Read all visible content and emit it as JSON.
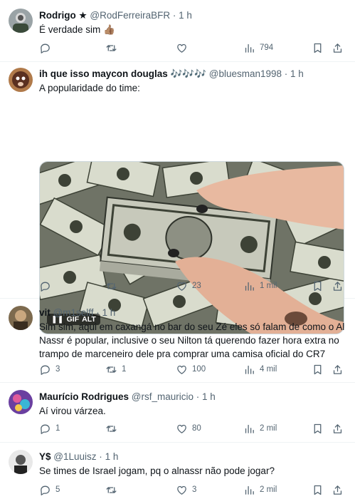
{
  "tweets": [
    {
      "name": "Rodrigo ★",
      "handle": "@RodFerreiraBFR",
      "time": "1 h",
      "text": "É verdade sim 👍🏽",
      "replies": "",
      "retweets": "",
      "likes": "",
      "views": "794"
    },
    {
      "name": "ih que isso maycon douglas 🎶🎶🎶",
      "handle": "@bluesman1998",
      "time": "1 h",
      "text": "A popularidade do time:",
      "replies": "",
      "retweets": "",
      "likes": "23",
      "views": "1 mil",
      "media": {
        "gif_label": "GIF",
        "alt_label": "ALT",
        "pause_icon": "pause-icon"
      }
    },
    {
      "name": "vit",
      "handle": "@m1selff",
      "time": "1 h",
      "text": "Sim sim, aqui em caxangá no bar do seu Zé eles só falam de como o Al Nassr é popular, inclusive o seu Nilton tá querendo fazer hora extra no trampo de marceneiro dele pra comprar uma camisa oficial do CR7",
      "replies": "3",
      "retweets": "1",
      "likes": "100",
      "views": "4 mil"
    },
    {
      "name": "Maurício Rodrigues",
      "handle": "@rsf_mauricio",
      "time": "1 h",
      "text": "Aí virou várzea.",
      "replies": "1",
      "retweets": "",
      "likes": "80",
      "views": "2 mil"
    },
    {
      "name": "Y$",
      "handle": "@1Luuisz",
      "time": "1 h",
      "text": "Se times de Israel jogam, pq o alnassr não pode jogar?",
      "replies": "5",
      "retweets": "",
      "likes": "3",
      "views": "2 mil"
    }
  ],
  "separator": "·",
  "colors": {
    "text": "#0f1419",
    "muted": "#536471",
    "border": "#eff3f4"
  },
  "icons": [
    "reply-icon",
    "retweet-icon",
    "like-icon",
    "views-icon",
    "bookmark-icon",
    "share-icon"
  ]
}
